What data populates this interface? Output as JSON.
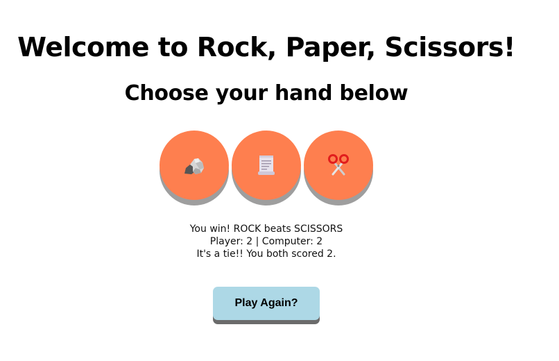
{
  "header": {
    "title": "Welcome to Rock, Paper, Scissors!",
    "subtitle": "Choose your hand below"
  },
  "hands": [
    {
      "id": "rock",
      "icon": "rock-icon"
    },
    {
      "id": "paper",
      "icon": "paper-scroll-icon"
    },
    {
      "id": "scissors",
      "icon": "scissors-icon"
    }
  ],
  "results": {
    "round_message": "You win! ROCK beats SCISSORS",
    "score_line": "Player: 2 | Computer: 2",
    "final_message": "It's a tie!! You both scored 2."
  },
  "actions": {
    "play_again_label": "Play Again?"
  },
  "colors": {
    "hand_button": "#fe7f4f",
    "hand_button_shadow": "#9e9e9e",
    "play_again_button": "#add8e6",
    "play_again_shadow": "#6b6b6b"
  }
}
